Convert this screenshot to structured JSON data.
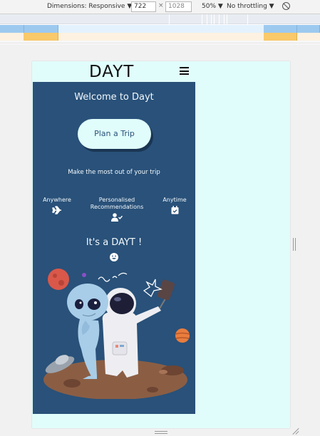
{
  "devtools": {
    "dimensions_label": "Dimensions: Responsive ▼",
    "width_value": "722",
    "times": "×",
    "height_value": "1028",
    "zoom_label": "50% ▼",
    "throttle_label": "No throttling ▼",
    "rotate_icon": "rotate-icon"
  },
  "page": {
    "logo": "DAYT",
    "menu_icon": "hamburger-icon",
    "welcome": "Welcome to Dayt",
    "plan_button": "Plan a Trip",
    "tagline": "Make the most out of your trip",
    "features": [
      {
        "label": "Anywhere",
        "icon": "plane-icon"
      },
      {
        "label": "Personalised Recommendations",
        "icon": "user-check-icon"
      },
      {
        "label": "Anytime",
        "icon": "calendar-check-icon"
      }
    ],
    "tagline2": "It's a DAYT !",
    "smile_icon": "smile-icon",
    "illustration": "alien-astronaut-selfie-illustration"
  },
  "colors": {
    "panel": "#295179",
    "page_bg": "#e0fdfb",
    "button_bg": "#e0fdfb",
    "button_text": "#295179"
  }
}
